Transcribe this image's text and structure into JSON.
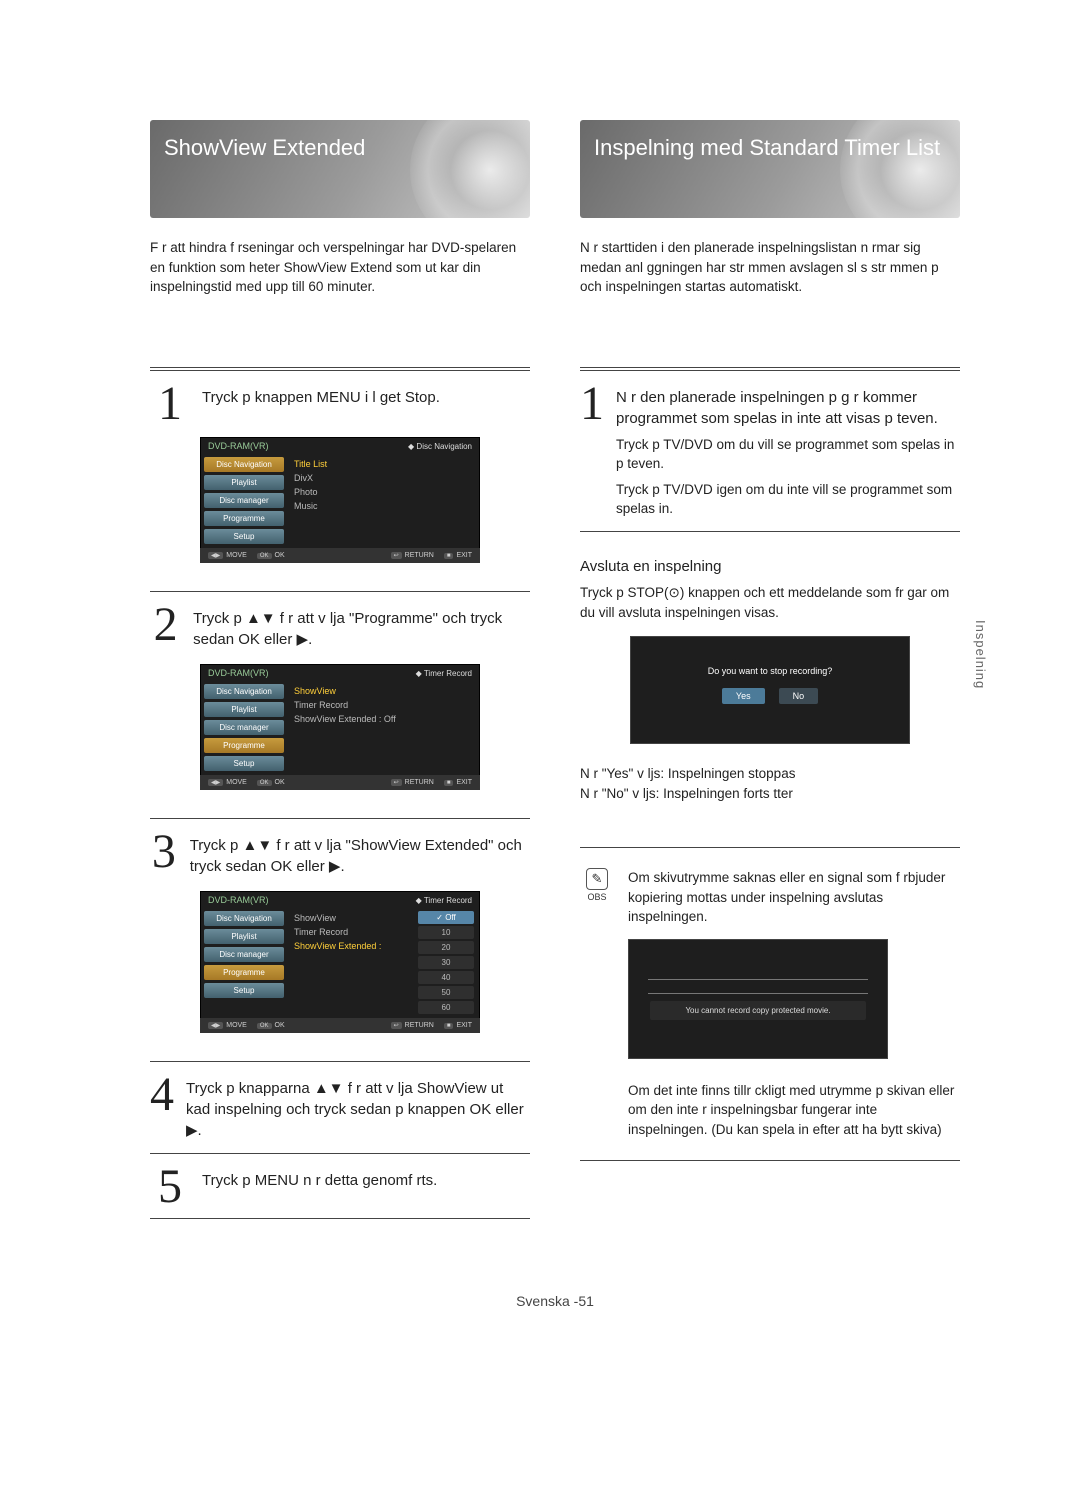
{
  "side_tab": "Inspelning",
  "footer": {
    "lang": "Svenska -",
    "page": "51"
  },
  "left": {
    "title": "ShowView Extended",
    "intro": "F r att hindra f rseningar och  verspelningar har DVD-spelaren en funktion som heter ShowView Extend som ut kar din inspelningstid med upp till 60 minuter.",
    "steps": {
      "s1": {
        "num": "1",
        "text": "Tryck p  knappen  MENU i l get Stop.",
        "osd": {
          "tl": "DVD-RAM(VR)",
          "tr": "Disc Navigation",
          "side": [
            "Disc Navigation",
            "Playlist",
            "Disc manager",
            "Programme",
            "Setup"
          ],
          "main": [
            "Title List",
            "DivX",
            "Photo",
            "Music"
          ],
          "foot": [
            "MOVE",
            "OK",
            "RETURN",
            "EXIT"
          ]
        }
      },
      "s2": {
        "num": "2",
        "text": "Tryck p  ▲▼ f r att v lja \"Programme\" och tryck sedan OK eller ▶.",
        "osd": {
          "tl": "DVD-RAM(VR)",
          "tr": "Timer Record",
          "side": [
            "Disc Navigation",
            "Playlist",
            "Disc manager",
            "Programme",
            "Setup"
          ],
          "main": [
            "ShowView",
            "Timer Record",
            "ShowView Extended : Off"
          ],
          "foot": [
            "MOVE",
            "OK",
            "RETURN",
            "EXIT"
          ]
        }
      },
      "s3": {
        "num": "3",
        "text": "Tryck p  ▲▼ f r att v lja \"ShowView Extended\" och tryck sedan OK eller ▶.",
        "osd": {
          "tl": "DVD-RAM(VR)",
          "tr": "Timer Record",
          "side": [
            "Disc Navigation",
            "Playlist",
            "Disc manager",
            "Programme",
            "Setup"
          ],
          "main": [
            "ShowView",
            "Timer Record",
            "ShowView Extended :"
          ],
          "submenu": [
            "Off",
            "10",
            "20",
            "30",
            "40",
            "50",
            "60"
          ],
          "foot": [
            "MOVE",
            "OK",
            "RETURN",
            "EXIT"
          ]
        }
      },
      "s4": {
        "num": "4",
        "text": "Tryck p  knapparna ▲▼ f r att v lja ShowView ut kad inspelning och tryck sedan p  knappen  OK eller ▶."
      },
      "s5": {
        "num": "5",
        "text": "Tryck p  MENU n r detta genomf rts."
      }
    }
  },
  "right": {
    "title": "Inspelning med Standard Timer List",
    "intro": "N r starttiden i den planerade inspelningslistan n rmar sig medan anl ggningen har str mmen avslagen sl s str mmen p  och inspelningen startas automatiskt.",
    "step1": {
      "num": "1",
      "text": "N r den planerade inspelningen p g r kommer programmet som spelas in inte att visas p  teven.",
      "sub1": "Tryck p  TV/DVD om du vill se programmet som spelas in p  teven.",
      "sub2": "Tryck p  TV/DVD igen om du inte vill se programmet som spelas in."
    },
    "end_rec": {
      "head": "Avsluta en inspelning",
      "body": "Tryck p  STOP(⊙) knappen och ett meddelande som fr gar om du vill avsluta inspelningen visas.",
      "yes_line": "N r \"Yes\" v ljs: Inspelningen stoppas",
      "no_line": "N r \"No\" v ljs: Inspelningen forts tter",
      "dialog_msg": "Do you want to stop recording?",
      "yes": "Yes",
      "no": "No"
    },
    "obs": {
      "label": "OBS",
      "p1": "Om skivutrymme saknas eller en signal som f rbjuder kopiering mottas under inspelning avslutas inspelningen.",
      "cp_msg": "You cannot record copy protected movie.",
      "p2": "Om det inte finns tillr ckligt med utrymme p  skivan eller om den inte  r inspelningsbar fungerar inte inspelningen. (Du kan spela in efter att ha bytt skiva)"
    }
  }
}
